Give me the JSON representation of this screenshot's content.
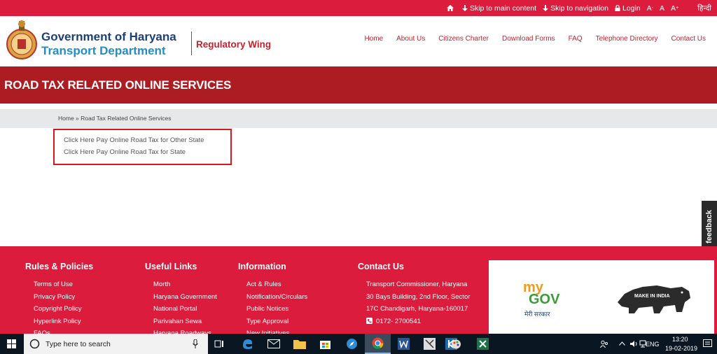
{
  "topbar": {
    "skip_main": "Skip to main content",
    "skip_nav": "Skip to navigation",
    "login": "Login",
    "font_small": "A",
    "font_normal": "A",
    "font_large": "A",
    "font_large_sup": "+",
    "font_small_sup": "-",
    "lang": "हिन्दी"
  },
  "header": {
    "title_line1": "Government of Haryana",
    "title_line2": "Transport Department",
    "wing": "Regulatory Wing",
    "nav": [
      "Home",
      "About Us",
      "Citizens Charter",
      "Download Forms",
      "FAQ",
      "Telephone Directory",
      "Contact Us"
    ]
  },
  "banner": {
    "title": "ROAD TAX RELATED ONLINE SERVICES"
  },
  "breadcrumb": {
    "home": "Home",
    "separator": " » ",
    "current": "Road Tax Related Online Services"
  },
  "links": [
    "Click Here Pay Online Road Tax for Other State",
    "Click Here Pay Online Road Tax for State"
  ],
  "feedback": "feedback",
  "footer": {
    "rules": {
      "title": "Rules & Policies",
      "items": [
        "Terms of Use",
        "Privacy Policy",
        "Copyright Policy",
        "Hyperlink Policy",
        "FAQs"
      ]
    },
    "useful": {
      "title": "Useful Links",
      "items": [
        "Morth",
        "Haryana Government",
        "National Portal",
        "Parivahan Sewa",
        "Haryana Roadways"
      ]
    },
    "info": {
      "title": "Information",
      "items": [
        "Act & Rules",
        "Notification/Circulars",
        "Public Notices",
        "Type Approval",
        "New Initiatives"
      ]
    },
    "contact": {
      "title": "Contact Us",
      "lines": [
        "Transport Commissioner, Haryana",
        "30 Bays Building, 2nd Floor, Sector",
        "17C Chandigarh, Haryana-160017"
      ],
      "phone": "0172- 2700541"
    },
    "mygov": {
      "my": "my",
      "gov": "GOV",
      "tagline": "मेरी सरकार"
    },
    "makeinindia": "MAKE IN INDIA"
  },
  "taskbar": {
    "search_placeholder": "Type here to search",
    "lang": "ENG",
    "time": "13:20",
    "date": "19-02-2019"
  },
  "colors": {
    "brand_red": "#dc1c3c",
    "banner_red": "#ac1c22",
    "navy": "#1a3f7a",
    "blue": "#1f8fc6"
  }
}
